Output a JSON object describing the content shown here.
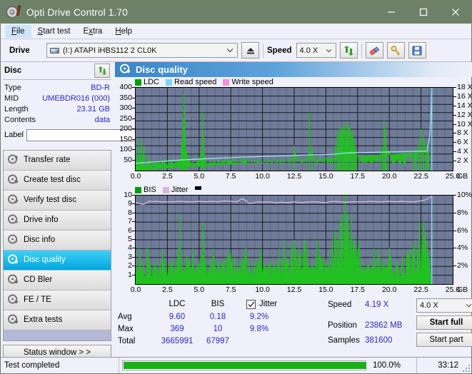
{
  "window": {
    "title": "Opti Drive Control 1.70",
    "icon": "disc-marker-icon",
    "minimize": "minimize",
    "maximize": "maximize",
    "close": "close",
    "titlebar_color": "#6d8169"
  },
  "menu": {
    "items": [
      {
        "label": "File",
        "accel": "F",
        "selected": true
      },
      {
        "label": "Start test",
        "accel": "S",
        "selected": false
      },
      {
        "label": "Extra",
        "accel": "x",
        "selected": false
      },
      {
        "label": "Help",
        "accel": "H",
        "selected": false
      }
    ]
  },
  "toolbar": {
    "drive_label": "Drive",
    "drive_value": "(I:)   ATAPI iHBS112   2 CL0K",
    "eject_icon": "eject-icon",
    "speed_label": "Speed",
    "speed_value": "4.0 X",
    "refresh_icon": "refresh-icon",
    "eraser_icon": "eraser-icon",
    "bookmark_icon": "keys-icon",
    "save_icon": "save-icon"
  },
  "disc": {
    "header": "Disc",
    "refresh_icon": "refresh-icon",
    "rows": [
      {
        "key": "Type",
        "value": "BD-R"
      },
      {
        "key": "MID",
        "value": "UMEBDR016 (000)"
      },
      {
        "key": "Length",
        "value": "23.31 GB"
      },
      {
        "key": "Contents",
        "value": "data"
      }
    ],
    "label_key": "Label",
    "label_value": "",
    "label_placeholder": "",
    "disc_icon": "disc-icon"
  },
  "nav": {
    "items": [
      {
        "label": "Transfer rate",
        "icon": "disc-speed-icon",
        "active": false
      },
      {
        "label": "Create test disc",
        "icon": "disc-create-icon",
        "active": false
      },
      {
        "label": "Verify test disc",
        "icon": "disc-verify-icon",
        "active": false
      },
      {
        "label": "Drive info",
        "icon": "drive-info-icon",
        "active": false
      },
      {
        "label": "Disc info",
        "icon": "disc-info-icon",
        "active": false
      },
      {
        "label": "Disc quality",
        "icon": "disc-quality-icon",
        "active": true
      },
      {
        "label": "CD Bler",
        "icon": "disc-bler-icon",
        "active": false
      },
      {
        "label": "FE / TE",
        "icon": "disc-fete-icon",
        "active": false
      },
      {
        "label": "Extra tests",
        "icon": "disc-extra-icon",
        "active": false
      }
    ],
    "status_window": "Status window > >"
  },
  "panel": {
    "title": "Disc quality",
    "icon": "disc-quality-icon"
  },
  "stats": {
    "col_ldc": "LDC",
    "col_bis": "BIS",
    "row_avg": "Avg",
    "row_max": "Max",
    "row_total": "Total",
    "avg_ldc": "9.60",
    "avg_bis": "0.18",
    "max_ldc": "369",
    "max_bis": "10",
    "total_ldc": "3665991",
    "total_bis": "67997",
    "jitter_label": "Jitter",
    "jitter_checked": true,
    "jitter_avg": "9.2%",
    "jitter_max": "9.8%",
    "speed_label": "Speed",
    "speed_value": "4.19 X",
    "position_label": "Position",
    "position_value": "23862 MB",
    "samples_label": "Samples",
    "samples_value": "381600",
    "speed_select": "4.0 X",
    "start_full": "Start full",
    "start_part": "Start part"
  },
  "statusbar": {
    "message": "Test completed",
    "percent": "100.0%",
    "progress": 100,
    "elapsed": "33:12",
    "progress_color": "#18b218"
  },
  "chart_data": [
    {
      "type": "area",
      "id": "ldc-chart",
      "title": "",
      "xlabel": "GB",
      "ylabel": "",
      "xlim": [
        0,
        25
      ],
      "ylim": [
        0,
        400
      ],
      "xticks": [
        0.0,
        2.5,
        5.0,
        7.5,
        10.0,
        12.5,
        15.0,
        17.5,
        20.0,
        22.5,
        25.0
      ],
      "xticklabels": [
        "0.0",
        "2.5",
        "5.0",
        "7.5",
        "10.0",
        "12.5",
        "15.0",
        "17.5",
        "20.0",
        "22.5",
        "25.0"
      ],
      "xunit": "GB",
      "yticks": [
        50,
        100,
        150,
        200,
        250,
        300,
        350,
        400
      ],
      "yticklabels": [
        "50",
        "100",
        "150",
        "200",
        "250",
        "300",
        "350",
        "400"
      ],
      "y2lim": [
        0,
        18
      ],
      "y2ticks": [
        2,
        4,
        6,
        8,
        10,
        12,
        14,
        16,
        18
      ],
      "y2ticklabels": [
        "2 X",
        "4 X",
        "6 X",
        "8 X",
        "10 X",
        "12 X",
        "14 X",
        "16 X",
        "18 X"
      ],
      "grid": true,
      "legend": [
        {
          "label": "LDC",
          "color": "#00a000"
        },
        {
          "label": "Read speed",
          "color": "#79d7f2"
        },
        {
          "label": "Write speed",
          "color": "#f58fd6"
        }
      ],
      "plot_bg": "#6e7b99",
      "series": [
        {
          "name": "LDC",
          "color": "#22c022",
          "kind": "spikes",
          "x": [
            0.05,
            0.15,
            0.25,
            0.35,
            0.45,
            0.55,
            0.65,
            0.75,
            0.85,
            0.95,
            1.05,
            1.15,
            1.3,
            1.5,
            1.7,
            1.9,
            2.1,
            2.3,
            2.5,
            2.7,
            2.9,
            3.1,
            3.3,
            3.5,
            3.6,
            3.7,
            3.8,
            3.85,
            3.9,
            4.0,
            4.1,
            4.3,
            4.5,
            4.7,
            4.9,
            5.1,
            5.25,
            5.35,
            5.4,
            5.5,
            5.7,
            5.9,
            6.1,
            6.3,
            6.5,
            6.7,
            6.9,
            7.1,
            7.3,
            7.5,
            7.7,
            7.9,
            8.1,
            8.3,
            8.5,
            8.7,
            8.9,
            9.1,
            9.3,
            9.5,
            9.7,
            9.9,
            10.1,
            10.3,
            10.5,
            10.7,
            10.9,
            11.1,
            11.3,
            11.5,
            11.7,
            11.9,
            12.1,
            12.3,
            12.5,
            12.7,
            12.9,
            13.1,
            13.3,
            13.5,
            13.7,
            13.9,
            14.1,
            14.3,
            14.5,
            14.7,
            14.9,
            15.1,
            15.3,
            15.5,
            15.7,
            15.9,
            16.0,
            16.1,
            16.2,
            16.3,
            16.4,
            16.5,
            16.6,
            16.7,
            16.8,
            16.9,
            17.0,
            17.1,
            17.2,
            17.3,
            17.4,
            17.5,
            17.6,
            17.7,
            17.8,
            17.9,
            18.1,
            18.3,
            18.5,
            18.7,
            18.9,
            19.1,
            19.3,
            19.5,
            19.6,
            19.7,
            19.9,
            20.1,
            20.3,
            20.5,
            20.7,
            20.9,
            21.1,
            21.3,
            21.5,
            21.7,
            21.9,
            22.1,
            22.3,
            22.5,
            22.7,
            22.9,
            23.0,
            23.1,
            23.2,
            23.3
          ],
          "y": [
            95,
            60,
            140,
            70,
            155,
            80,
            120,
            60,
            55,
            70,
            50,
            45,
            40,
            38,
            40,
            42,
            45,
            40,
            38,
            44,
            40,
            42,
            45,
            50,
            120,
            250,
            370,
            300,
            180,
            90,
            55,
            48,
            42,
            46,
            50,
            60,
            290,
            180,
            90,
            55,
            48,
            44,
            40,
            42,
            46,
            40,
            38,
            42,
            44,
            40,
            38,
            42,
            46,
            40,
            44,
            38,
            42,
            40,
            44,
            46,
            40,
            42,
            38,
            44,
            40,
            46,
            42,
            40,
            44,
            38,
            42,
            46,
            40,
            44,
            120,
            60,
            50,
            46,
            40,
            44,
            280,
            120,
            60,
            50,
            44,
            40,
            46,
            42,
            50,
            60,
            110,
            170,
            195,
            210,
            185,
            215,
            200,
            225,
            190,
            230,
            205,
            215,
            180,
            190,
            150,
            120,
            95,
            80,
            70,
            60,
            55,
            50,
            46,
            42,
            40,
            44,
            50,
            60,
            120,
            90,
            240,
            200,
            110,
            70,
            55,
            60,
            50,
            45,
            48,
            55,
            60,
            70,
            90,
            110,
            150,
            200,
            170,
            140,
            120,
            95
          ]
        },
        {
          "name": "Read speed",
          "color": "#9fe0f5",
          "kind": "line",
          "x": [
            0.0,
            0.6,
            1.1,
            1.6,
            2.2,
            3.0,
            3.8,
            4.6,
            5.4,
            6.2,
            7.0,
            7.8,
            8.6,
            9.4,
            10.2,
            11.0,
            11.8,
            12.6,
            13.4,
            14.2,
            15.0,
            15.8,
            16.4,
            17.0,
            17.6,
            18.4,
            19.2,
            20.0,
            20.8,
            21.6,
            22.4,
            23.0,
            23.2,
            23.3,
            23.35
          ],
          "y": [
            1.6,
            1.7,
            1.8,
            1.9,
            2.0,
            2.2,
            2.35,
            2.45,
            2.55,
            2.65,
            2.75,
            2.85,
            2.95,
            3.0,
            3.1,
            3.15,
            3.2,
            3.3,
            3.4,
            3.45,
            3.5,
            3.6,
            3.8,
            3.85,
            3.9,
            3.95,
            4.0,
            4.05,
            4.1,
            4.15,
            4.2,
            4.25,
            8.0,
            14.0,
            18.0
          ]
        }
      ]
    },
    {
      "type": "area",
      "id": "bis-chart",
      "title": "",
      "xlabel": "GB",
      "ylabel": "",
      "xlim": [
        0,
        25
      ],
      "ylim": [
        0,
        10
      ],
      "xticks": [
        0.0,
        2.5,
        5.0,
        7.5,
        10.0,
        12.5,
        15.0,
        17.5,
        20.0,
        22.5,
        25.0
      ],
      "xticklabels": [
        "0.0",
        "2.5",
        "5.0",
        "7.5",
        "10.0",
        "12.5",
        "15.0",
        "17.5",
        "20.0",
        "22.5",
        "25.0"
      ],
      "xunit": "GB",
      "yticks": [
        1,
        2,
        3,
        4,
        5,
        6,
        7,
        8,
        9,
        10
      ],
      "yticklabels": [
        "1",
        "2",
        "3",
        "4",
        "5",
        "6",
        "7",
        "8",
        "9",
        "10"
      ],
      "y2lim": [
        0,
        10
      ],
      "y2ticks": [
        2,
        4,
        6,
        8,
        10
      ],
      "y2ticklabels": [
        "2%",
        "4%",
        "6%",
        "8%",
        "10%"
      ],
      "grid": true,
      "legend": [
        {
          "label": "BIS",
          "color": "#00a000"
        },
        {
          "label": "Jitter",
          "color": "#d8b7d8"
        }
      ],
      "plot_bg": "#6e7b99",
      "series": [
        {
          "name": "BIS",
          "color": "#22c022",
          "kind": "spikes",
          "x": [
            0.1,
            0.3,
            0.5,
            0.7,
            0.9,
            1.1,
            1.3,
            1.5,
            1.7,
            1.9,
            2.1,
            2.3,
            2.5,
            2.7,
            2.9,
            3.1,
            3.3,
            3.5,
            3.7,
            3.8,
            3.9,
            4.1,
            4.3,
            4.5,
            4.7,
            4.9,
            5.1,
            5.3,
            5.35,
            5.5,
            5.7,
            5.9,
            6.1,
            6.3,
            6.5,
            6.7,
            6.9,
            7.1,
            7.3,
            7.5,
            7.7,
            7.9,
            8.1,
            8.3,
            8.5,
            8.7,
            8.9,
            9.1,
            9.3,
            9.5,
            9.7,
            9.9,
            10.1,
            10.3,
            10.5,
            10.7,
            10.9,
            11.1,
            11.3,
            11.5,
            11.7,
            11.9,
            12.1,
            12.3,
            12.5,
            12.7,
            12.9,
            13.1,
            13.3,
            13.5,
            13.7,
            13.9,
            14.1,
            14.3,
            14.5,
            14.7,
            14.9,
            15.1,
            15.3,
            15.5,
            15.7,
            15.9,
            16.1,
            16.3,
            16.5,
            16.6,
            16.7,
            16.8,
            16.9,
            17.0,
            17.2,
            17.4,
            17.6,
            17.8,
            18.0,
            18.2,
            18.4,
            18.6,
            18.8,
            19.0,
            19.2,
            19.4,
            19.6,
            19.8,
            20.0,
            20.2,
            20.4,
            20.6,
            20.8,
            21.0,
            21.2,
            21.4,
            21.6,
            21.8,
            22.0,
            22.2,
            22.4,
            22.6,
            22.7,
            22.8,
            22.9,
            23.0,
            23.1,
            23.2,
            23.3
          ],
          "y": [
            3,
            4,
            3,
            2,
            4,
            3,
            2,
            3,
            1,
            3,
            4,
            2,
            3,
            2,
            3,
            2,
            3,
            8,
            2,
            1,
            2,
            3,
            2,
            4,
            3,
            2,
            3,
            7,
            6,
            3,
            2,
            3,
            4,
            2,
            3,
            2,
            3,
            2,
            4,
            3,
            2,
            3,
            2,
            3,
            2,
            4,
            3,
            2,
            3,
            2,
            3,
            4,
            2,
            3,
            2,
            3,
            2,
            3,
            4,
            2,
            5,
            3,
            2,
            4,
            5,
            3,
            4,
            3,
            5,
            4,
            3,
            2,
            3,
            5,
            4,
            3,
            2,
            3,
            4,
            5,
            6,
            5,
            7,
            8,
            10,
            7,
            8,
            6,
            5,
            8,
            5,
            4,
            5,
            3,
            2,
            3,
            2,
            3,
            4,
            3,
            4,
            2,
            3,
            2,
            4,
            3,
            2,
            3,
            2,
            3,
            2,
            3,
            4,
            3,
            5,
            4,
            7,
            5,
            7,
            6,
            5,
            4,
            3,
            2,
            1
          ]
        },
        {
          "name": "Jitter",
          "color": "#d9b9e0",
          "kind": "line",
          "x": [
            0.0,
            0.3,
            0.6,
            0.9,
            1.1,
            1.3,
            1.6,
            2.0,
            2.5,
            3.0,
            3.5,
            4.0,
            4.5,
            5.0,
            5.5,
            6.0,
            6.5,
            7.0,
            7.5,
            8.0,
            8.3,
            8.5,
            8.7,
            8.9,
            9.0,
            9.3,
            9.6,
            10.0,
            10.5,
            11.0,
            11.5,
            12.0,
            12.5,
            13.0,
            13.5,
            14.0,
            14.5,
            15.0,
            15.3,
            15.6,
            16.0,
            16.5,
            17.0,
            17.5,
            18.0,
            18.5,
            19.0,
            19.5,
            20.0,
            20.5,
            21.0,
            21.5,
            22.0,
            22.5,
            22.8,
            23.0,
            23.2,
            23.3
          ],
          "y": [
            9.2,
            9.1,
            9.0,
            9.2,
            9.4,
            9.3,
            9.35,
            9.3,
            9.3,
            9.3,
            9.35,
            9.3,
            9.3,
            9.35,
            9.3,
            9.35,
            9.3,
            9.4,
            9.35,
            9.3,
            9.6,
            9.6,
            9.4,
            9.2,
            9.1,
            9.2,
            9.3,
            9.25,
            9.3,
            9.2,
            9.25,
            9.2,
            9.3,
            9.2,
            9.25,
            9.3,
            9.25,
            9.2,
            9.3,
            9.35,
            9.3,
            9.25,
            9.3,
            9.3,
            9.3,
            9.35,
            9.3,
            9.3,
            9.35,
            9.3,
            9.35,
            9.3,
            9.3,
            9.4,
            9.5,
            9.6,
            9.8,
            9.9
          ]
        }
      ]
    }
  ]
}
